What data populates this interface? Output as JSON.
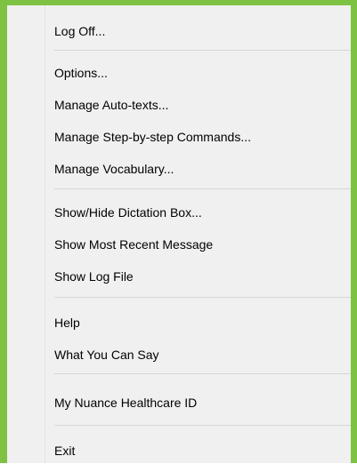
{
  "menu": {
    "items": [
      {
        "label": "Log Off..."
      },
      {
        "label": "Options..."
      },
      {
        "label": "Manage Auto-texts..."
      },
      {
        "label": "Manage Step-by-step Commands..."
      },
      {
        "label": "Manage Vocabulary..."
      },
      {
        "label": "Show/Hide Dictation Box..."
      },
      {
        "label": "Show Most Recent Message"
      },
      {
        "label": "Show Log File"
      },
      {
        "label": "Help"
      },
      {
        "label": "What You Can Say"
      },
      {
        "label": "My Nuance Healthcare ID"
      },
      {
        "label": "Exit"
      }
    ]
  },
  "colors": {
    "accent_border": "#7dc242",
    "menu_background": "#f0f0f0",
    "separator": "#d7d7d7"
  }
}
